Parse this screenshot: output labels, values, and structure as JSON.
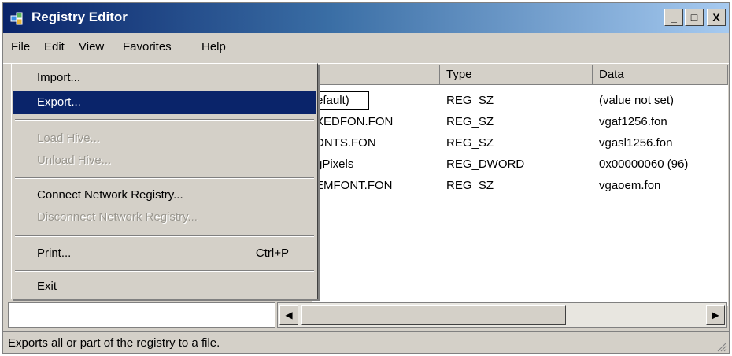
{
  "window": {
    "title": "Registry Editor",
    "controls": {
      "minimize": "_",
      "maximize": "□",
      "close": "X"
    }
  },
  "menubar": [
    "File",
    "Edit",
    "View",
    "Favorites",
    "Help"
  ],
  "file_menu": {
    "items": [
      {
        "label": "Import...",
        "state": "normal"
      },
      {
        "label": "Export...",
        "state": "highlighted"
      },
      {
        "label": "Load Hive...",
        "state": "disabled"
      },
      {
        "label": "Unload Hive...",
        "state": "disabled"
      },
      {
        "label": "Connect Network Registry...",
        "state": "normal"
      },
      {
        "label": "Disconnect Network Registry...",
        "state": "disabled"
      },
      {
        "label": "Print...",
        "shortcut": "Ctrl+P",
        "state": "normal"
      },
      {
        "label": "Exit",
        "state": "normal"
      }
    ]
  },
  "listview": {
    "columns": [
      "Type",
      "Data"
    ],
    "rows": [
      {
        "name": "efault)",
        "type": "REG_SZ",
        "data": "(value not set)"
      },
      {
        "name": "XEDFON.FON",
        "type": "REG_SZ",
        "data": "vgaf1256.fon"
      },
      {
        "name": "DNTS.FON",
        "type": "REG_SZ",
        "data": "vgasl1256.fon"
      },
      {
        "name": "gPixels",
        "type": "REG_DWORD",
        "data": "0x00000060 (96)"
      },
      {
        "name": "EMFONT.FON",
        "type": "REG_SZ",
        "data": "vgaoem.fon"
      }
    ]
  },
  "statusbar": {
    "text": "Exports all or part of the registry to a file."
  },
  "icons": [
    "registry-editor-icon",
    "scroll-left-icon",
    "scroll-right-icon",
    "size-grip-icon"
  ],
  "colors": {
    "titlebar_start": "#0a246a",
    "titlebar_end": "#a6caf0",
    "highlight": "#0a246a",
    "face": "#d4d0c8"
  }
}
